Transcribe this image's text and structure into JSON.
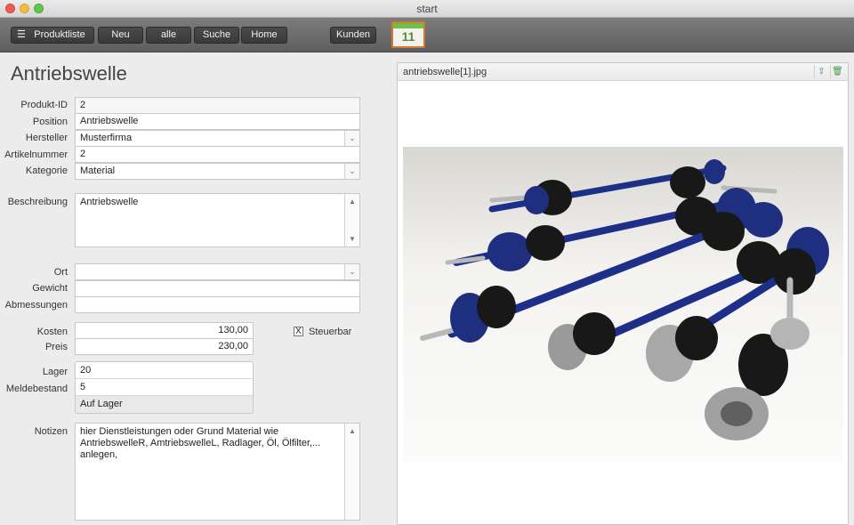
{
  "window": {
    "title": "start"
  },
  "toolbar": {
    "buttons": [
      "Produktliste",
      "Neu",
      "alle",
      "Suche",
      "Home"
    ],
    "kunden": "Kunden",
    "calendar_day": "11",
    "list_icon": "list-icon",
    "calendar_icon": "calendar-icon"
  },
  "form": {
    "heading": "Antriebswelle",
    "fields": {
      "produkt_id": {
        "label": "Produkt-ID",
        "value": "2"
      },
      "position": {
        "label": "Position",
        "value": "Antriebswelle"
      },
      "hersteller": {
        "label": "Hersteller",
        "value": "Musterfirma"
      },
      "artikelnummer": {
        "label": "Artikelnummer",
        "value": "2"
      },
      "kategorie": {
        "label": "Kategorie",
        "value": "Material"
      },
      "beschreibung": {
        "label": "Beschreibung",
        "value": "Antriebswelle"
      },
      "ort": {
        "label": "Ort",
        "value": ""
      },
      "gewicht": {
        "label": "Gewicht",
        "value": ""
      },
      "abmessungen": {
        "label": "Abmessungen",
        "value": ""
      },
      "kosten": {
        "label": "Kosten",
        "value": "130,00"
      },
      "preis": {
        "label": "Preis",
        "value": "230,00"
      },
      "steuerbar": {
        "label": "Steuerbar",
        "checked": true,
        "mark": "X"
      },
      "lager": {
        "label": "Lager",
        "value": "20"
      },
      "meldebestand": {
        "label": "Meldebestand",
        "value": "5"
      },
      "lager_status": "Auf Lager",
      "notizen": {
        "label": "Notizen",
        "value": "hier Dienstleistungen oder Grund Material wie AntriebswelleR, AmtriebswelleL, Radlager, Öl, Ölfilter,... anlegen,"
      }
    }
  },
  "image_panel": {
    "filename": "antriebswelle[1].jpg",
    "export_icon": "export-icon",
    "delete_icon": "trash-icon"
  },
  "colors": {
    "toolbar": "#6b6b6b",
    "button": "#3f3f3f",
    "shaft_blue": "#1e2f8a",
    "accent_green": "#3e9a3e"
  }
}
